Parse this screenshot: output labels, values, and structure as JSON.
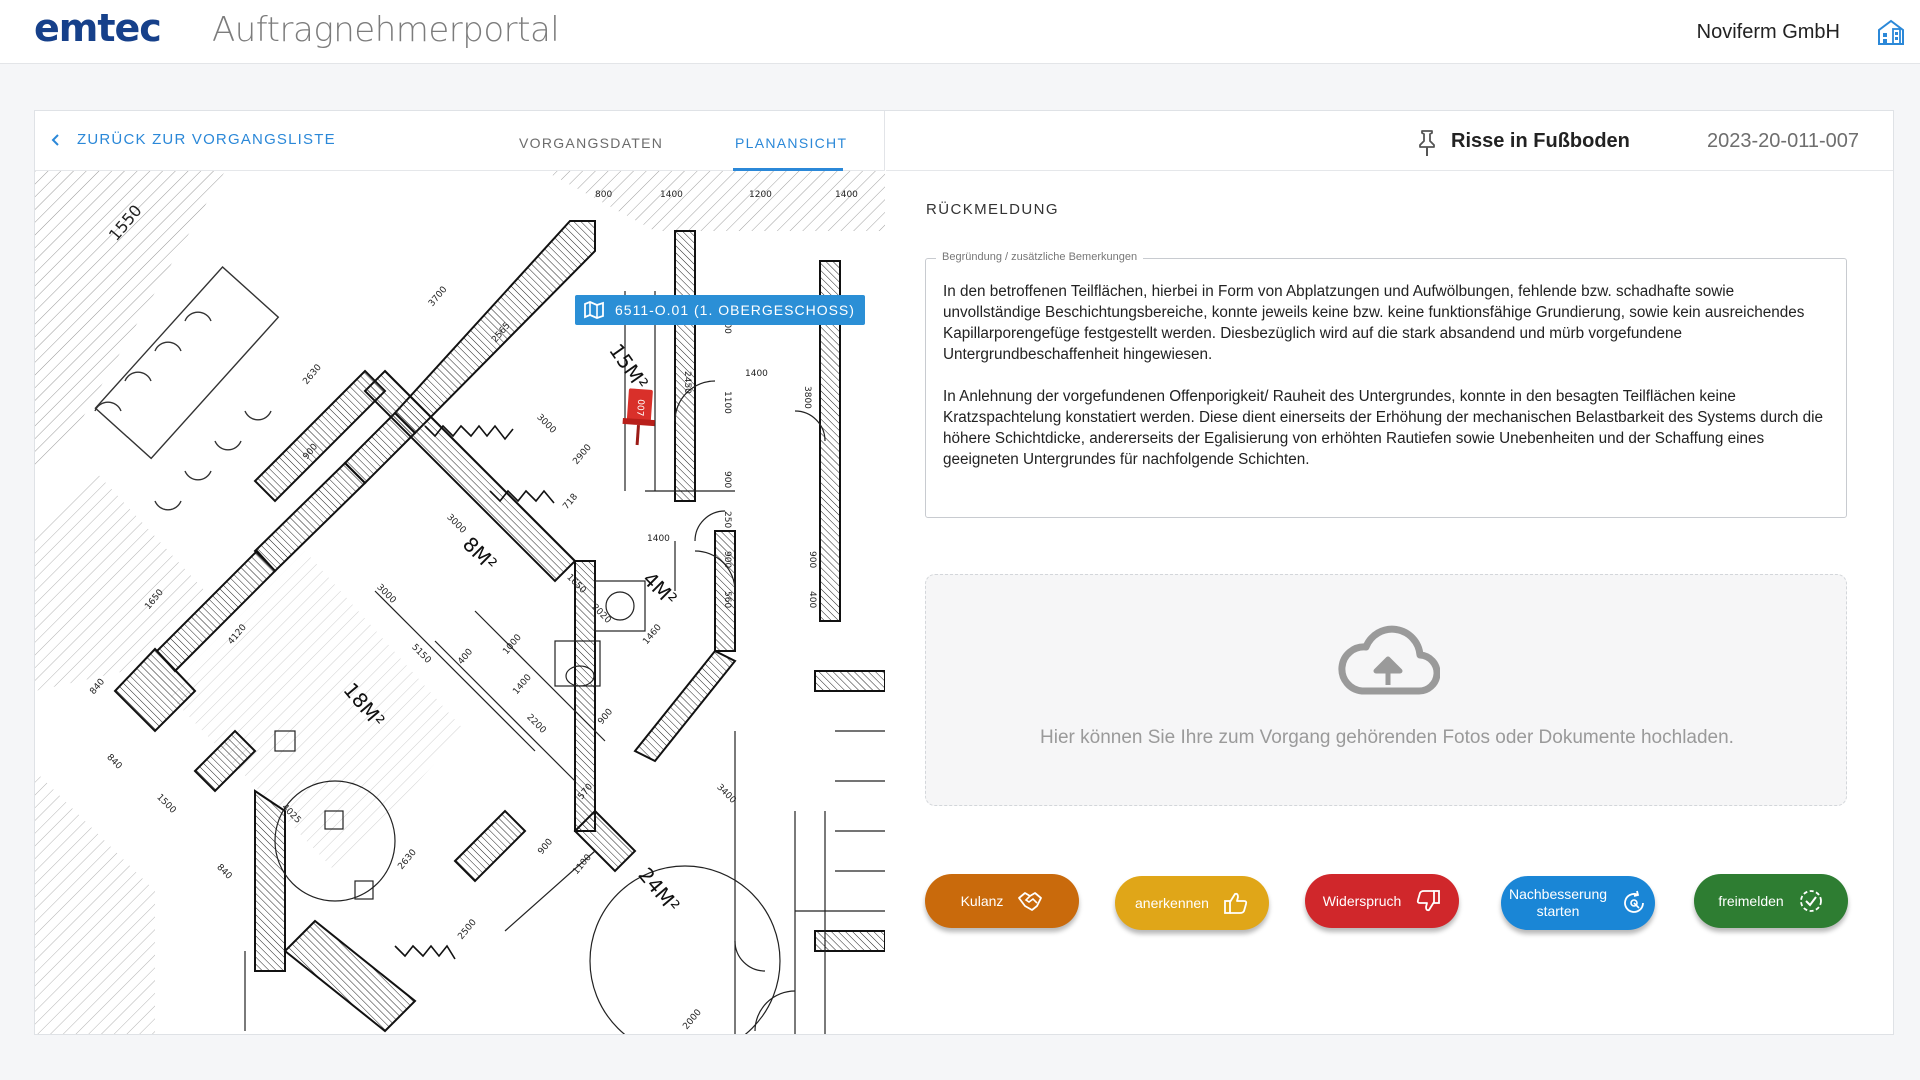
{
  "header": {
    "brand": "emtec",
    "portal_title": "Auftragnehmerportal",
    "company": "Noviferm GmbH"
  },
  "nav": {
    "back_label": "ZURÜCK ZUR VORGANGSLISTE",
    "tabs": [
      {
        "label": "VORGANGSDATEN",
        "active": false
      },
      {
        "label": "PLANANSICHT",
        "active": true
      }
    ]
  },
  "issue": {
    "title": "Risse in Fußboden",
    "id": "2023-20-011-007"
  },
  "plan": {
    "floor_label": "6511-O.01 (1. OBERGESCHOSS)",
    "pin_label": "007",
    "room_labels": [
      "15M²",
      "8M²",
      "4M²",
      "18M²",
      "24M²"
    ],
    "dimensions": [
      "1550",
      "800",
      "1400",
      "1200",
      "1400",
      "3700",
      "2565",
      "3000",
      "1100",
      "2450",
      "1400",
      "3800",
      "1100",
      "900",
      "250",
      "900",
      "560",
      "900",
      "400",
      "1400",
      "3000",
      "718",
      "1650",
      "2020",
      "1460",
      "3000",
      "4120",
      "5150",
      "1650",
      "400",
      "1000",
      "1400",
      "2200",
      "900",
      "570",
      "900",
      "1100",
      "840",
      "840",
      "1500",
      "840",
      "4025",
      "2630",
      "2500",
      "3400",
      "2000"
    ]
  },
  "feedback": {
    "section_title": "RÜCKMELDUNG",
    "field_label": "Begründung / zusätzliche Bemerkungen",
    "paragraphs": [
      "In den betroffenen Teilflächen, hierbei in Form von Abplatzungen und Aufwölbungen, fehlende bzw. schadhafte sowie unvollständige Beschichtungsbereiche, konnte jeweils keine bzw. keine funktionsfähige Grundierung, sowie kein ausreichendes Kapillarporengefüge festgestellt werden. Diesbezüglich wird auf die stark absandend und mürb vorgefundene Untergrundbeschaffenheit hingewiesen.",
      "In Anlehnung der vorgefundenen Offenporigkeit/ Rauheit des Untergrundes, konnte in den besagten Teilflächen keine Kratzspachtelung konstatiert werden. Diese dient einerseits der Erhöhung der mechanischen Belastbarkeit des Systems durch die höhere Schichtdicke, andererseits der Egalisierung von erhöhten Rautiefen sowie Unebenheiten und der Schaffung eines geeigneten Untergrundes für nachfolgende Schichten."
    ]
  },
  "upload": {
    "text": "Hier können Sie Ihre zum Vorgang gehörenden Fotos oder Dokumente hochladen.",
    "icon": "cloud-upload-icon"
  },
  "actions": [
    {
      "label": "Kulanz",
      "icon": "handshake-icon",
      "color": "#c96a0c"
    },
    {
      "label": "anerkennen",
      "icon": "thumbs-up-icon",
      "color": "#e0a618"
    },
    {
      "label": "Widerspruch",
      "icon": "thumbs-down-icon",
      "color": "#d0272b"
    },
    {
      "label": "Nachbesserung starten",
      "line1": "Nachbesserung",
      "line2": "starten",
      "icon": "restart-cog-icon",
      "color": "#1a86d6"
    },
    {
      "label": "freimelden",
      "icon": "check-circle-icon",
      "color": "#2e7d32"
    }
  ],
  "colors": {
    "brand": "#16408a",
    "accent": "#2b88d8",
    "pin": "#d9302a"
  }
}
